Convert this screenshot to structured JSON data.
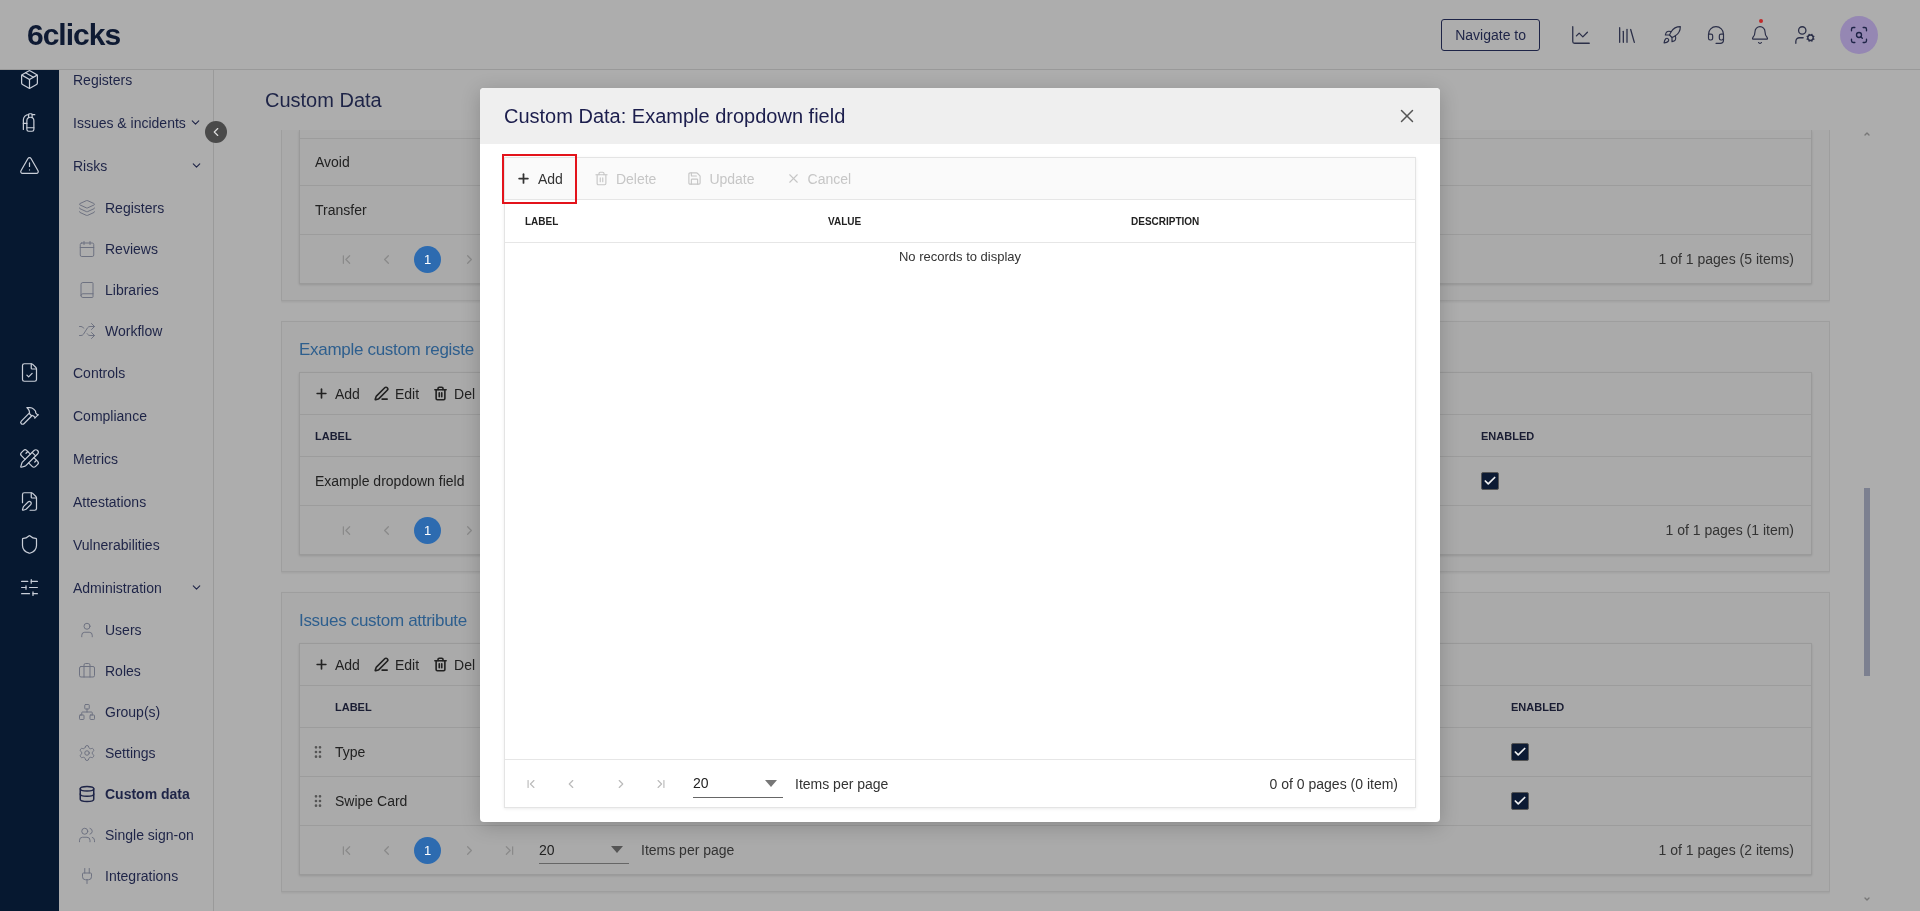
{
  "topbar": {
    "logo": "6clicks",
    "navigate_button": "Navigate to",
    "notifications": {
      "unread": true
    }
  },
  "sidebar": {
    "items": [
      {
        "label": "Registers",
        "expandable": false,
        "selected": false
      },
      {
        "label": "Issues & incidents",
        "expandable": true,
        "selected": false
      },
      {
        "label": "Risks",
        "expandable": true,
        "selected": false,
        "children": [
          {
            "label": "Registers",
            "selected": false
          },
          {
            "label": "Reviews",
            "selected": false
          },
          {
            "label": "Libraries",
            "selected": false
          },
          {
            "label": "Workflow",
            "selected": false
          }
        ]
      },
      {
        "label": "Controls",
        "expandable": false,
        "selected": false
      },
      {
        "label": "Compliance",
        "expandable": false,
        "selected": false
      },
      {
        "label": "Metrics",
        "expandable": false,
        "selected": false
      },
      {
        "label": "Attestations",
        "expandable": false,
        "selected": false
      },
      {
        "label": "Vulnerabilities",
        "expandable": false,
        "selected": false
      },
      {
        "label": "Administration",
        "expandable": true,
        "selected": false,
        "children": [
          {
            "label": "Users",
            "selected": false
          },
          {
            "label": "Roles",
            "selected": false
          },
          {
            "label": "Group(s)",
            "selected": false
          },
          {
            "label": "Settings",
            "selected": false
          },
          {
            "label": "Custom data",
            "selected": true
          },
          {
            "label": "Single sign-on",
            "selected": false
          },
          {
            "label": "Integrations",
            "selected": false
          }
        ]
      }
    ]
  },
  "page": {
    "title": "Custom Data",
    "cards": [
      {
        "draggable": false,
        "rows": [
          {
            "label": "Avoid"
          },
          {
            "label": "Transfer"
          }
        ],
        "pager": {
          "pages": [
            {
              "label": "1",
              "selected": true
            }
          ],
          "summary": "1 of 1 pages (5 items)"
        }
      },
      {
        "title": "Example custom registe",
        "draggable": false,
        "toolbar": [
          {
            "kind": "add",
            "label": "Add"
          },
          {
            "kind": "edit",
            "label": "Edit"
          },
          {
            "kind": "delete",
            "label": "Del"
          }
        ],
        "columns": [
          "LABEL",
          "ENABLED"
        ],
        "rows": [
          {
            "label": "Example dropdown field",
            "enabled": true
          }
        ],
        "pager": {
          "pages": [
            {
              "label": "1",
              "selected": true
            }
          ],
          "summary": "1 of 1 pages (1 item)"
        }
      },
      {
        "title": "Issues custom attribute",
        "draggable": true,
        "toolbar": [
          {
            "kind": "add",
            "label": "Add"
          },
          {
            "kind": "edit",
            "label": "Edit"
          },
          {
            "kind": "delete",
            "label": "Del"
          }
        ],
        "columns": [
          "LABEL",
          "ENABLED"
        ],
        "rows": [
          {
            "label": "Type",
            "enabled": true
          },
          {
            "label": "Swipe Card",
            "enabled": true
          }
        ],
        "pager": {
          "pages": [
            {
              "label": "1",
              "selected": true
            }
          ],
          "page_size": "20",
          "page_size_label": "Items per page",
          "summary": "1 of 1 pages (2 items)"
        }
      }
    ]
  },
  "modal": {
    "title": "Custom Data: Example dropdown field",
    "toolbar": [
      {
        "kind": "add",
        "label": "Add",
        "disabled": false,
        "highlighted": true
      },
      {
        "kind": "delete",
        "label": "Delete",
        "disabled": true,
        "highlighted": false
      },
      {
        "kind": "update",
        "label": "Update",
        "disabled": true,
        "highlighted": false
      },
      {
        "kind": "cancel",
        "label": "Cancel",
        "disabled": true,
        "highlighted": false
      }
    ],
    "columns": [
      "LABEL",
      "VALUE",
      "DESCRIPTION"
    ],
    "empty_message": "No records to display",
    "pager": {
      "page_size": "20",
      "page_size_label": "Items per page",
      "summary": "0 of 0 pages (0 item)"
    }
  }
}
